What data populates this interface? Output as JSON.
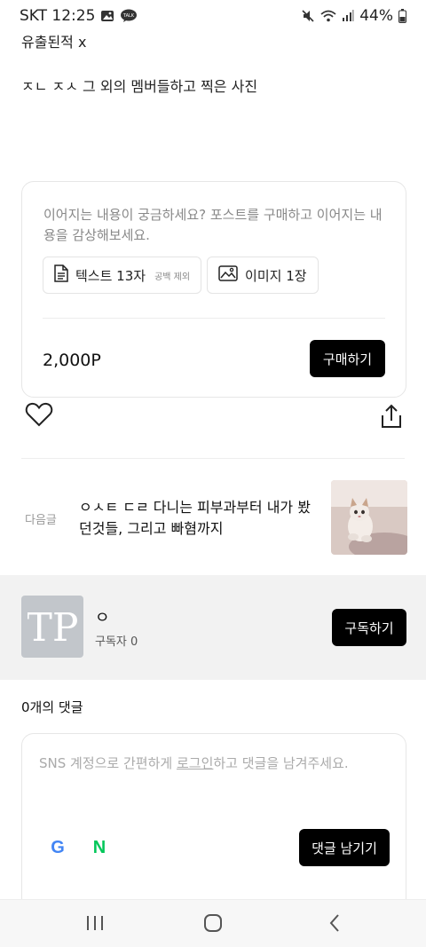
{
  "status_bar": {
    "carrier_time": "SKT 12:25",
    "battery": "44%",
    "talk_badge": "TALK"
  },
  "post": {
    "line1": "유출된적 x",
    "line2": "ㅈㄴ ㅈㅅ 그 외의 멤버들하고 찍은 사진"
  },
  "purchase": {
    "description": "이어지는 내용이 궁금하세요? 포스트를 구매하고 이어지는 내용을 감상해보세요.",
    "text_chip_label": "텍스트 13자",
    "text_chip_note": "공백 제외",
    "image_chip_label": "이미지 1장",
    "price": "2,000P",
    "buy_label": "구매하기"
  },
  "next_post": {
    "label": "다음글",
    "title": "ㅇㅅㅌ ㄷㄹ 다니는 피부과부터 내가 봤던것들, 그리고 빠혐까지"
  },
  "profile": {
    "name": "ㅇ",
    "subscribers": "구독자 0",
    "subscribe_label": "구독하기",
    "avatar_text": "TP"
  },
  "comments": {
    "count_title": "0개의 댓글",
    "placeholder_before": "SNS 계정으로 간편하게 ",
    "login_link": "로그인",
    "placeholder_after": "하고 댓글을 남겨주세요.",
    "google_letter": "G",
    "naver_letter": "N",
    "submit_label": "댓글 남기기"
  },
  "colors": {
    "button_bg": "#000000",
    "profile_bg": "#f2f2f2",
    "google_blue": "#4285F4",
    "naver_green": "#03C75A"
  }
}
